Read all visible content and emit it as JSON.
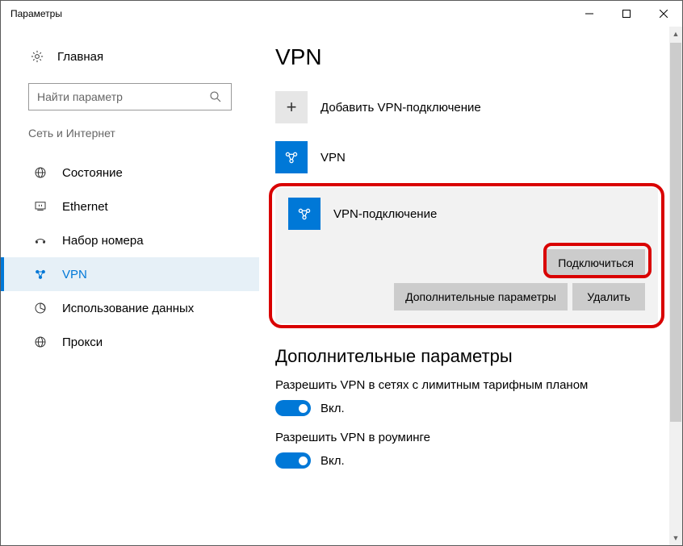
{
  "window": {
    "title": "Параметры"
  },
  "sidebar": {
    "home_label": "Главная",
    "search_placeholder": "Найти параметр",
    "category": "Сеть и Интернет",
    "items": [
      {
        "label": "Состояние"
      },
      {
        "label": "Ethernet"
      },
      {
        "label": "Набор номера"
      },
      {
        "label": "VPN"
      },
      {
        "label": "Использование данных"
      },
      {
        "label": "Прокси"
      }
    ]
  },
  "main": {
    "title": "VPN",
    "add_vpn_label": "Добавить VPN-подключение",
    "connections": [
      {
        "label": "VPN"
      },
      {
        "label": "VPN-подключение"
      }
    ],
    "connect_label": "Подключиться",
    "advanced_label": "Дополнительные параметры",
    "delete_label": "Удалить",
    "extra_heading": "Дополнительные параметры",
    "settings": [
      {
        "label": "Разрешить VPN в сетях с лимитным тарифным планом",
        "on_label": "Вкл."
      },
      {
        "label": "Разрешить VPN в роуминге",
        "on_label": "Вкл."
      }
    ]
  }
}
